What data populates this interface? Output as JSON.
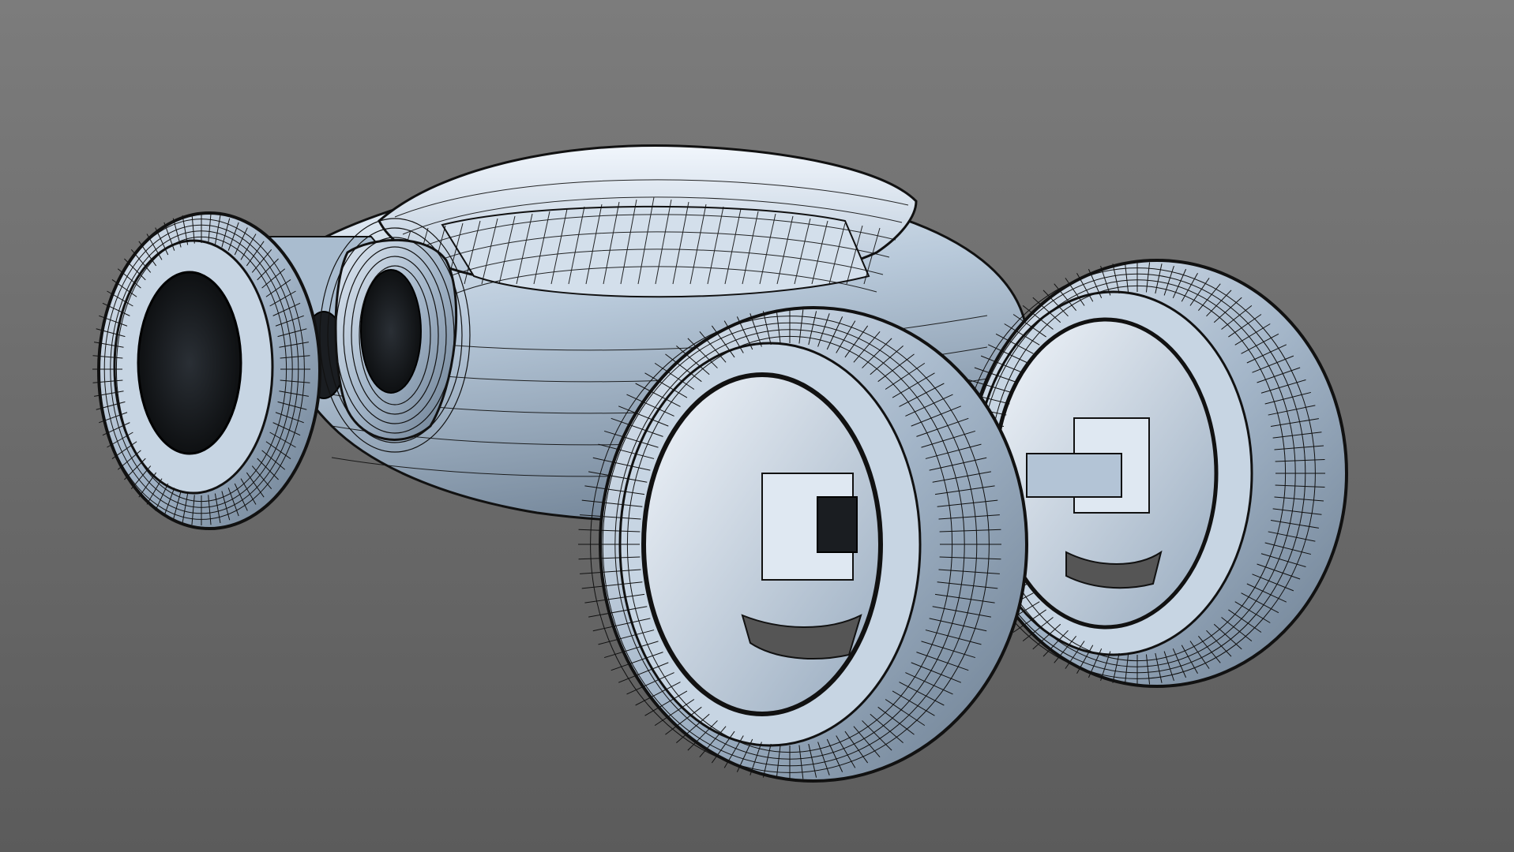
{
  "viewport": {
    "background_top": "#7b7b7b",
    "background_bottom": "#5a5a5a",
    "display_mode": "shaded-with-wireframe"
  },
  "model": {
    "subject": "concept-vehicle-mesh",
    "shade_light": "#e6eef8",
    "shade_mid": "#a9bccf",
    "shade_dark": "#6d7f92",
    "wire_color": "#0d0d0d"
  }
}
